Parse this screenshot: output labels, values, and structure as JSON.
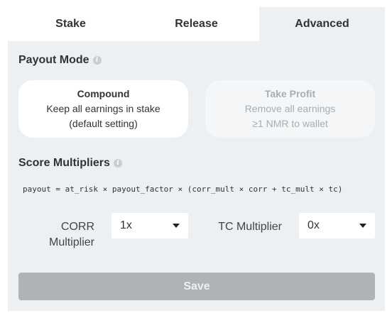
{
  "tabs": [
    {
      "label": "Stake",
      "active": false
    },
    {
      "label": "Release",
      "active": false
    },
    {
      "label": "Advanced",
      "active": true
    }
  ],
  "payout_mode": {
    "title": "Payout Mode",
    "options": [
      {
        "title": "Compound",
        "line1": "Keep all earnings in stake",
        "line2": "(default setting)",
        "selected": true
      },
      {
        "title": "Take Profit",
        "line1": "Remove all earnings",
        "line2": "≥1 NMR to wallet",
        "selected": false
      }
    ]
  },
  "score_multipliers": {
    "title": "Score Multipliers",
    "formula": "payout = at_risk × payout_factor × (corr_mult × corr + tc_mult × tc)",
    "corr": {
      "label_line1": "CORR",
      "label_line2": "Multiplier",
      "value": "1x"
    },
    "tc": {
      "label": "TC Multiplier",
      "value": "0x"
    }
  },
  "save_label": "Save",
  "colors": {
    "panel_bg": "#ecf0f2",
    "save_bg": "#aeb3b6"
  }
}
